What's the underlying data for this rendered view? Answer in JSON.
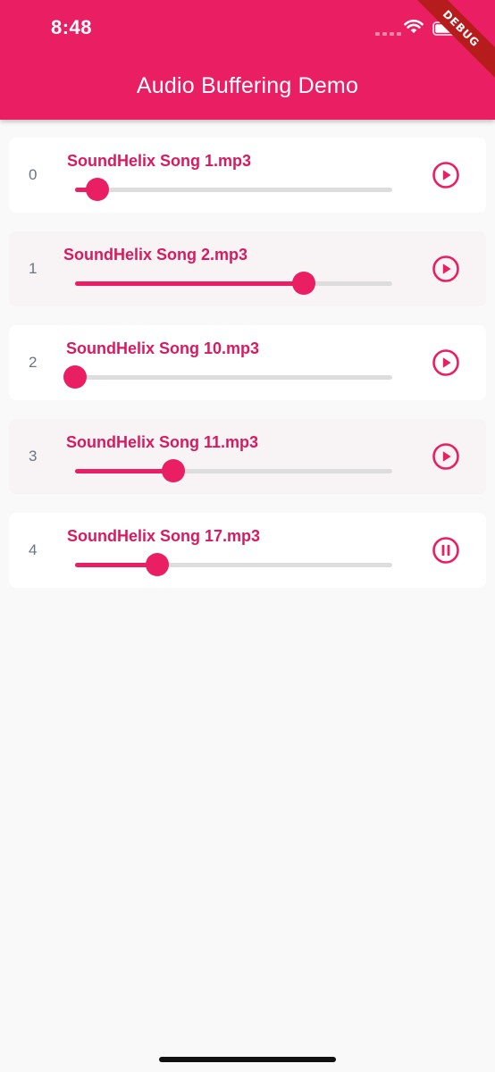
{
  "status_bar": {
    "time": "8:48"
  },
  "debug_banner": "DEBUG",
  "app_bar": {
    "title": "Audio Buffering Demo"
  },
  "colors": {
    "accent": "#e91e63",
    "title_text": "#d81b60",
    "index_text": "#6b7385",
    "track_bg": "#dddddd"
  },
  "tracks": [
    {
      "index": "0",
      "title": "SoundHelix Song 1.mp3",
      "progress_fraction": 0.07,
      "state": "play",
      "icon": "play-circle-icon"
    },
    {
      "index": "1",
      "title": "SoundHelix Song 2.mp3",
      "progress_fraction": 0.72,
      "state": "play",
      "icon": "play-circle-icon"
    },
    {
      "index": "2",
      "title": "SoundHelix Song 10.mp3",
      "progress_fraction": 0.0,
      "state": "play",
      "icon": "play-circle-icon"
    },
    {
      "index": "3",
      "title": "SoundHelix Song 11.mp3",
      "progress_fraction": 0.31,
      "state": "play",
      "icon": "play-circle-icon"
    },
    {
      "index": "4",
      "title": "SoundHelix Song 17.mp3",
      "progress_fraction": 0.26,
      "state": "pause",
      "icon": "pause-circle-icon"
    }
  ]
}
